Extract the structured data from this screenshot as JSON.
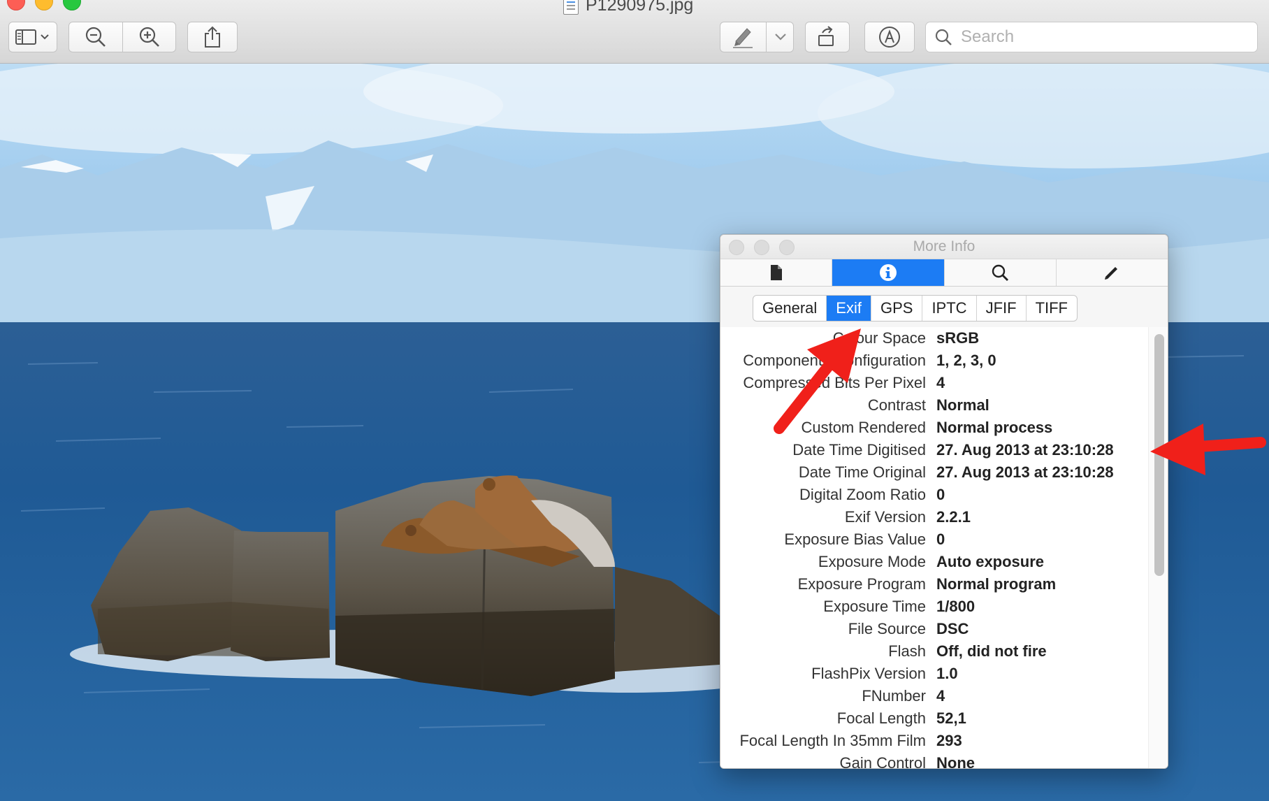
{
  "window": {
    "filename": "P1290975.jpg"
  },
  "toolbar": {
    "sidebar_button": "sidebar-toggle-icon",
    "zoom_out": "zoom-out-icon",
    "zoom_in": "zoom-in-icon",
    "share": "share-icon",
    "markup": "pencil-icon",
    "rotate": "rotate-icon",
    "annotate": "markup-circle-icon",
    "search_placeholder": "Search"
  },
  "panel": {
    "title": "More Info",
    "icon_tabs": [
      "document-icon",
      "info-icon",
      "magnifier-icon",
      "pencil-icon"
    ],
    "active_icon_tab": 1,
    "tabs": [
      "General",
      "Exif",
      "GPS",
      "IPTC",
      "JFIF",
      "TIFF"
    ],
    "active_tab": "Exif",
    "rows": [
      {
        "key": "Colour Space",
        "value": "sRGB"
      },
      {
        "key": "Components Configuration",
        "value": "1, 2, 3, 0"
      },
      {
        "key": "Compressed Bits Per Pixel",
        "value": "4"
      },
      {
        "key": "Contrast",
        "value": "Normal"
      },
      {
        "key": "Custom Rendered",
        "value": "Normal process"
      },
      {
        "key": "Date Time Digitised",
        "value": "27. Aug 2013 at 23:10:28"
      },
      {
        "key": "Date Time Original",
        "value": "27. Aug 2013 at 23:10:28"
      },
      {
        "key": "Digital Zoom Ratio",
        "value": "0"
      },
      {
        "key": "Exif Version",
        "value": "2.2.1"
      },
      {
        "key": "Exposure Bias Value",
        "value": "0"
      },
      {
        "key": "Exposure Mode",
        "value": "Auto exposure"
      },
      {
        "key": "Exposure Program",
        "value": "Normal program"
      },
      {
        "key": "Exposure Time",
        "value": "1/800"
      },
      {
        "key": "File Source",
        "value": "DSC"
      },
      {
        "key": "Flash",
        "value": "Off, did not fire"
      },
      {
        "key": "FlashPix Version",
        "value": "1.0"
      },
      {
        "key": "FNumber",
        "value": "4"
      },
      {
        "key": "Focal Length",
        "value": "52,1"
      },
      {
        "key": "Focal Length In 35mm Film",
        "value": "293"
      },
      {
        "key": "Gain Control",
        "value": "None"
      }
    ]
  },
  "colors": {
    "accent": "#1c7cf4",
    "arrow": "#f0201a",
    "sea": "#1f5a95",
    "sky": "#8fc0e6"
  }
}
